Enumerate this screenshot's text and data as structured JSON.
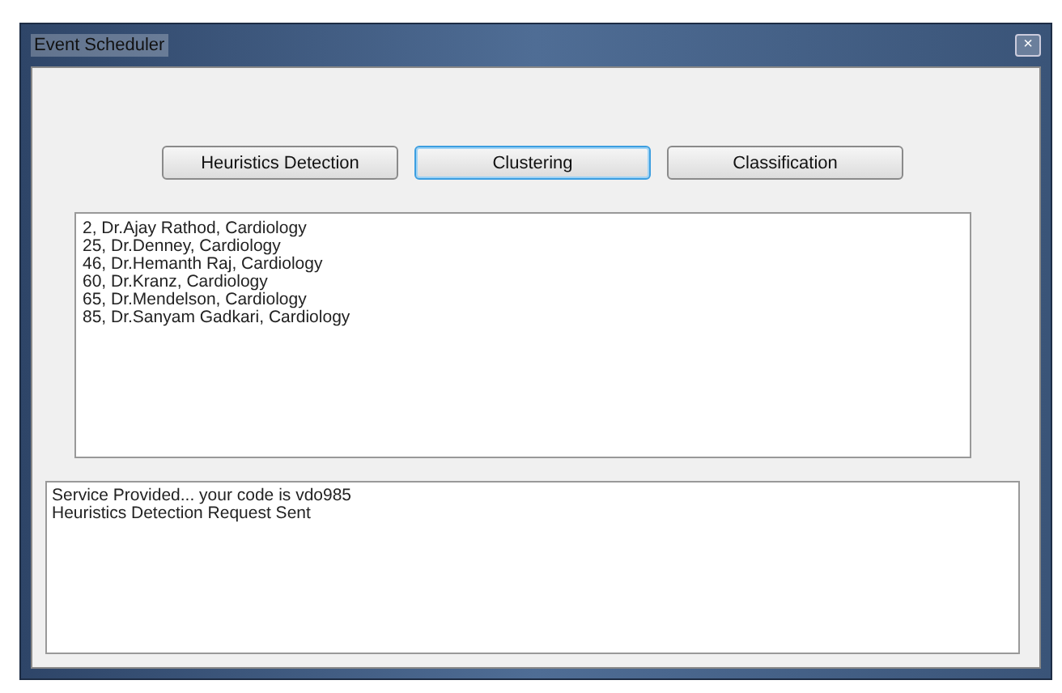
{
  "window": {
    "title": "Event Scheduler",
    "close": "×"
  },
  "buttons": [
    {
      "label": "Heuristics Detection",
      "focused": false
    },
    {
      "label": "Clustering",
      "focused": true
    },
    {
      "label": "Classification",
      "focused": false
    }
  ],
  "list": [
    "2, Dr.Ajay Rathod, Cardiology",
    "25, Dr.Denney, Cardiology",
    "46, Dr.Hemanth Raj, Cardiology",
    "60, Dr.Kranz, Cardiology",
    "65, Dr.Mendelson, Cardiology",
    "85, Dr.Sanyam Gadkari, Cardiology"
  ],
  "log": [
    "Service Provided... your code is vdo985",
    "Heuristics Detection Request Sent"
  ]
}
